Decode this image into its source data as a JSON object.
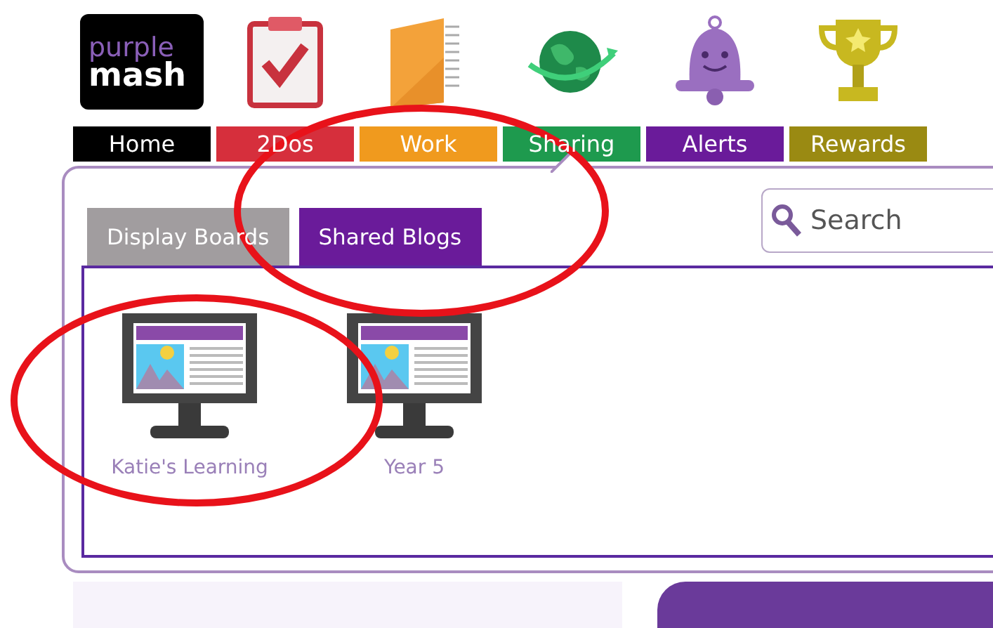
{
  "logo": {
    "line_1": "purple",
    "line_2": "mash"
  },
  "nav": [
    {
      "label": "Home",
      "color": "#000000",
      "selected": false
    },
    {
      "label": "2Dos",
      "color": "#d62f3c",
      "selected": false
    },
    {
      "label": "Work",
      "color": "#f09a1e",
      "selected": false
    },
    {
      "label": "Sharing",
      "color": "#1e9a4e",
      "selected": true
    },
    {
      "label": "Alerts",
      "color": "#6a1b9a",
      "selected": false
    },
    {
      "label": "Rewards",
      "color": "#9a8a12",
      "selected": false
    }
  ],
  "tabs": [
    {
      "label": "Display Boards",
      "selected": false
    },
    {
      "label": "Shared Blogs",
      "selected": true
    }
  ],
  "search": {
    "placeholder": "Search"
  },
  "blogs": [
    {
      "label": "Katie's Learning"
    },
    {
      "label": "Year 5"
    }
  ],
  "annotations": [
    {
      "kind": "ellipse"
    },
    {
      "kind": "ellipse"
    }
  ]
}
